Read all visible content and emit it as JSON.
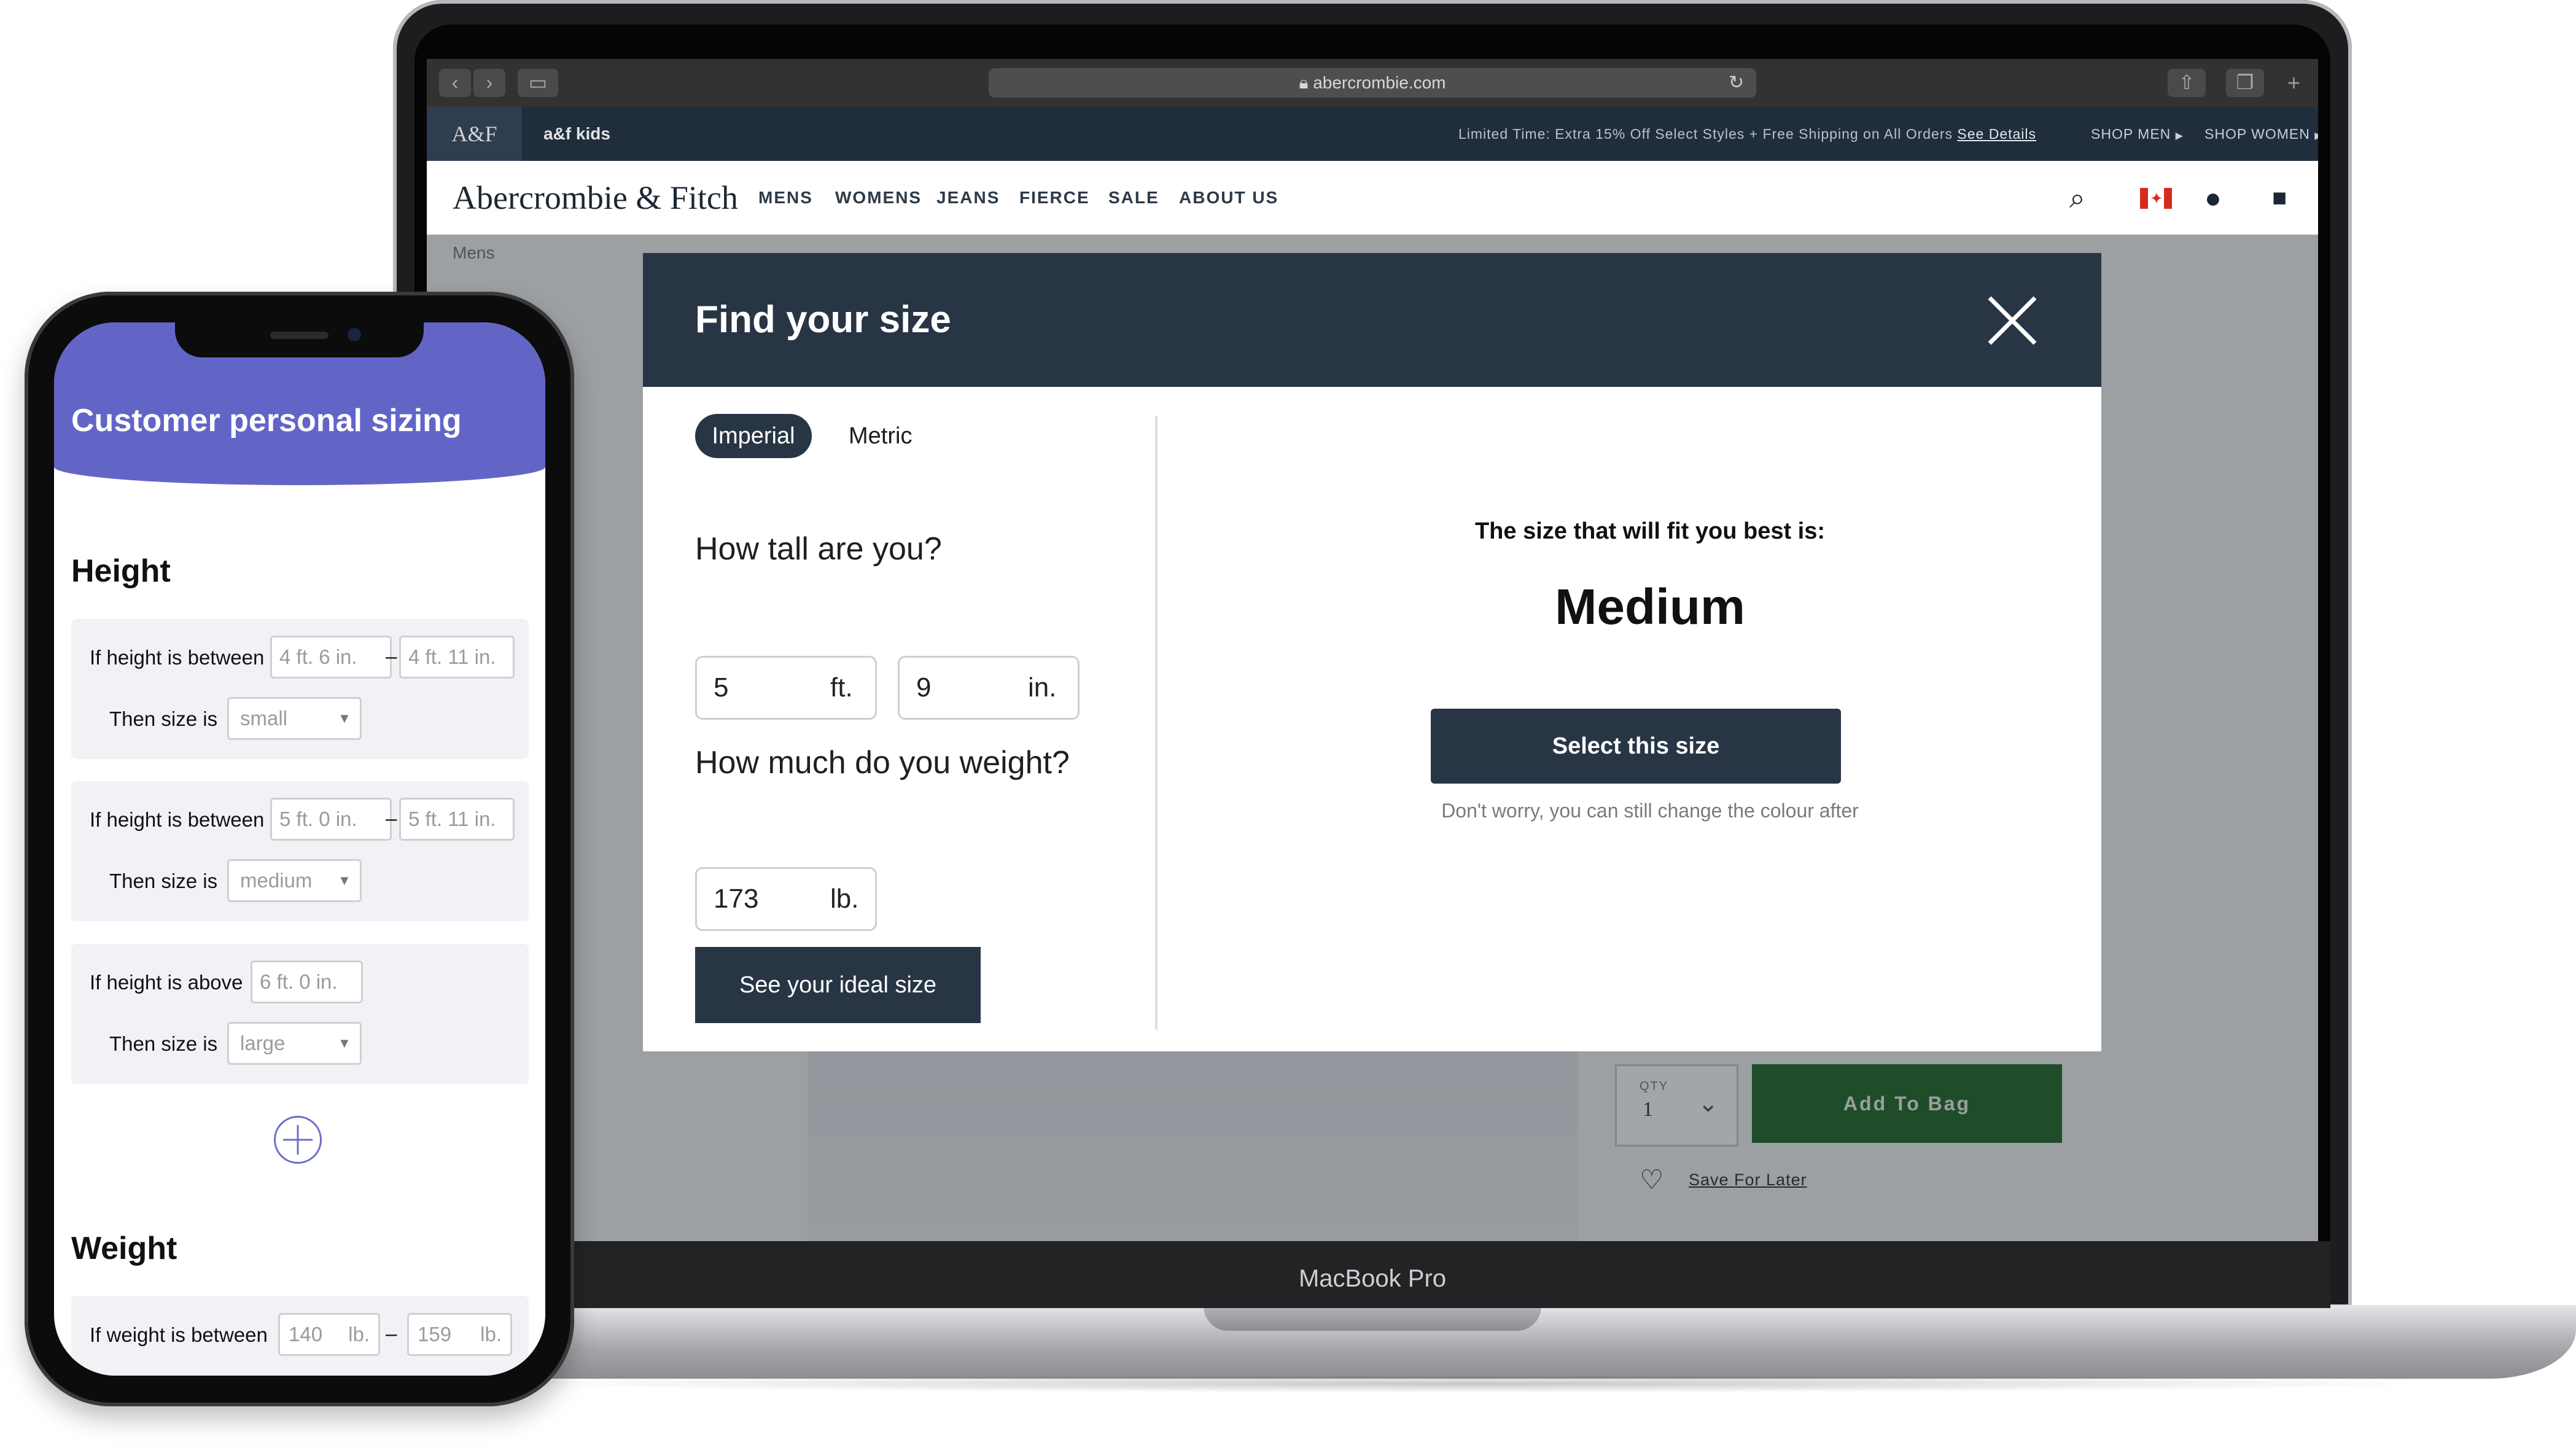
{
  "browser": {
    "url": "abercrombie.com"
  },
  "promo": {
    "logo": "A&F",
    "kids": "a&f kids",
    "text": "Limited Time: Extra 15% Off Select Styles + Free Shipping on All Orders",
    "link": "See Details",
    "shop_men": "SHOP MEN",
    "shop_women": "SHOP WOMEN"
  },
  "site": {
    "brand": "Abercrombie & Fitch",
    "nav": [
      "MENS",
      "WOMENS",
      "JEANS",
      "FIERCE",
      "SALE",
      "ABOUT US"
    ],
    "breadcrumb": "Mens"
  },
  "product": {
    "qty_label": "QTY",
    "qty_value": "1",
    "add_to_bag": "Add To Bag",
    "save_later": "Save For Later"
  },
  "modal": {
    "title": "Find your size",
    "toggle": {
      "imperial": "Imperial",
      "metric": "Metric"
    },
    "height_question": "How tall are you?",
    "height_ft": "5",
    "height_ft_unit": "ft.",
    "height_in": "9",
    "height_in_unit": "in.",
    "weight_question": "How much do you weight?",
    "weight": "173",
    "weight_unit": "lb.",
    "see_ideal": "See your ideal size",
    "result_label": "The size that will fit you best is:",
    "result_size": "Medium",
    "select_size": "Select this size",
    "reassure": "Don't worry, you can still change the colour after"
  },
  "laptop": {
    "label": "MacBook Pro"
  },
  "phone": {
    "title": "Customer personal sizing",
    "height_section": "Height",
    "weight_section": "Weight",
    "rules": [
      {
        "condition": "If height is between",
        "from": "4 ft.  6  in.",
        "to": "4 ft. 11 in.",
        "then": "Then size is",
        "size": "small"
      },
      {
        "condition": "If height is between",
        "from": "5 ft.  0  in.",
        "to": "5 ft. 11 in.",
        "then": "Then size is",
        "size": "medium"
      },
      {
        "condition": "If height is above",
        "from": "6 ft.  0  in.",
        "then": "Then size is",
        "size": "large"
      }
    ],
    "weight_rule": {
      "condition": "If weight is between",
      "from": "140",
      "from_unit": "lb.",
      "to": "159",
      "to_unit": "lb."
    }
  },
  "colors": {
    "modal_navy": "#283545",
    "phone_header": "#6365c6",
    "add_to_bag": "#266b2c",
    "promo_bar": "#1f2d3d"
  }
}
